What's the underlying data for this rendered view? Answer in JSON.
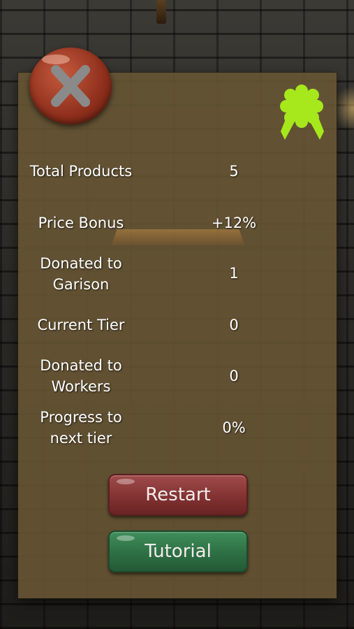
{
  "stats": {
    "total_products": {
      "label": "Total Products",
      "value": "5"
    },
    "price_bonus": {
      "label": "Price Bonus",
      "value": "+12%"
    },
    "donated_garison": {
      "label_line1": "Donated to",
      "label_line2": "Garison",
      "value": "1"
    },
    "current_tier": {
      "label": "Current Tier",
      "value": "0"
    },
    "donated_workers": {
      "label_line1": "Donated to",
      "label_line2": "Workers",
      "value": "0"
    },
    "progress": {
      "label_line1": "Progress to",
      "label_line2": "next tier",
      "value": "0%"
    }
  },
  "buttons": {
    "restart_label": "Restart",
    "tutorial_label": "Tutorial"
  },
  "icons": {
    "close": "close-icon",
    "ribbon": "ribbon-award-icon"
  },
  "colors": {
    "panel": "#69563a",
    "close_button": "#8e2f1c",
    "restart_button": "#833232",
    "tutorial_button": "#2e6f44",
    "ribbon": "#a6e81c"
  }
}
